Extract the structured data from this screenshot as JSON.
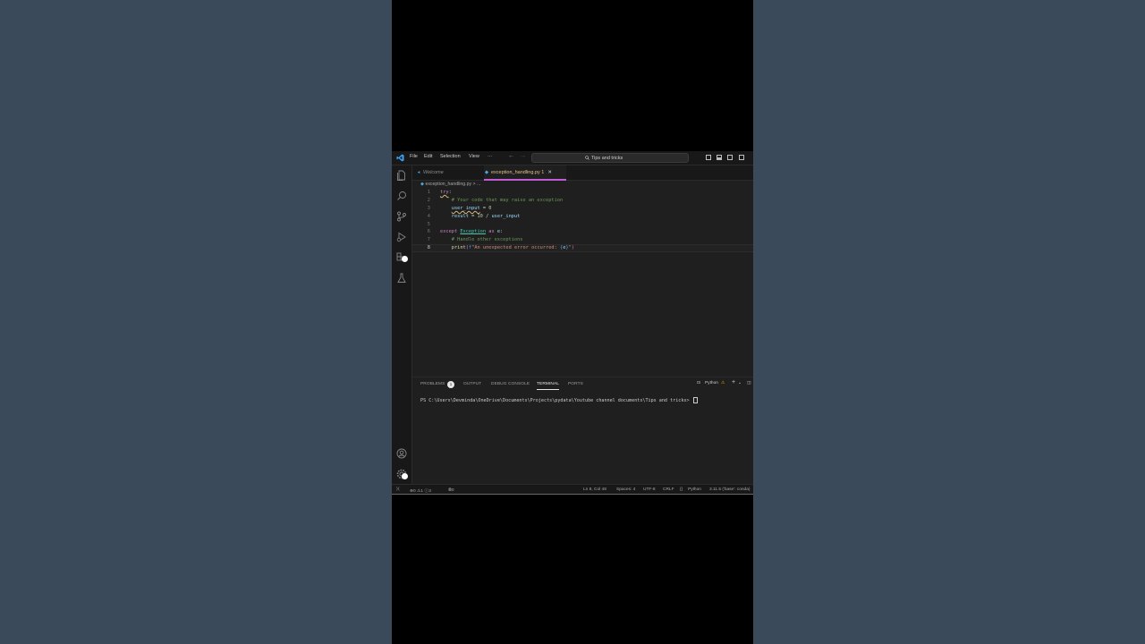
{
  "menu": {
    "items": [
      "File",
      "Edit",
      "Selection",
      "View",
      "···"
    ]
  },
  "search": {
    "placeholder": "Tips and tricks"
  },
  "tabs": [
    {
      "label": "Welcome"
    },
    {
      "label": "exception_handling.py 1",
      "close": "✕"
    }
  ],
  "breadcrumb": {
    "file": "exception_handling.py",
    "sep": ">",
    "rest": "..."
  },
  "code": {
    "line_numbers": [
      "1",
      "2",
      "3",
      "4",
      "5",
      "6",
      "7",
      "8"
    ],
    "l1_kw": "try",
    "l1_rest": ":",
    "l2_comment": "# Your code that may raise an exception",
    "l3_var": "user_input",
    "l3_op": " = ",
    "l3_num": "0",
    "l4_var": "result",
    "l4_op": " = ",
    "l4_num": "10",
    "l4_div": " / ",
    "l4_var2": "user_input",
    "l6_kw": "except",
    "l6_cls": "Exception",
    "l6_as": "as",
    "l6_var": "e",
    "l6_colon": ":",
    "l7_comment": "# Handle other exceptions",
    "l8_fn": "print",
    "l8_open": "(",
    "l8_f": "f",
    "l8_str": "\"An unexpected error occurred: ",
    "l8_brace_open": "{",
    "l8_e": "e",
    "l8_brace_close": "}",
    "l8_str_end": "\"",
    "l8_close": ")"
  },
  "panel": {
    "tabs": [
      "PROBLEMS",
      "OUTPUT",
      "DEBUG CONSOLE",
      "TERMINAL",
      "PORTS"
    ],
    "problems_count": "1",
    "terminal_label": "Python",
    "prompt": "PS C:\\Users\\Devminda\\OneDrive\\Documents\\Projects\\pydata\\Youtube channel documents\\Tips and tricks> "
  },
  "status": {
    "errors": "0",
    "warnings": "1",
    "info": "3",
    "ports": "0",
    "position": "Ln 8, Col 48",
    "spaces": "Spaces: 4",
    "encoding": "UTF-8",
    "eol": "CRLF",
    "language": "Python",
    "interpreter": "3.11.5 ('base': conda)"
  },
  "colors": {
    "accent": "#c25bd6",
    "editor_bg": "#1f1f1f",
    "page_bg": "#3b4a5b"
  }
}
